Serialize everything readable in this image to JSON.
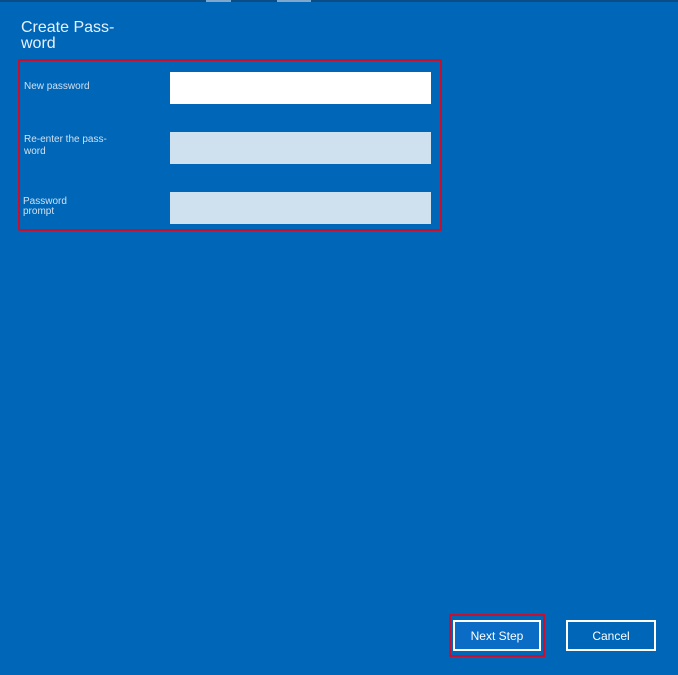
{
  "dialog": {
    "title": "Create Pass-word"
  },
  "form": {
    "fields": [
      {
        "label": "New password",
        "value": "",
        "placeholder": ""
      },
      {
        "label": "Re-enter the pass-word",
        "value": "",
        "placeholder": ""
      },
      {
        "label": "Password prompt",
        "value": "",
        "placeholder": ""
      }
    ]
  },
  "buttons": {
    "next_label": "Next Step",
    "cancel_label": "Cancel"
  },
  "colors": {
    "background": "#0067b8",
    "highlight_border": "#c8102e",
    "input_active": "#ffffff",
    "input_idle": "#cfe0ee"
  }
}
